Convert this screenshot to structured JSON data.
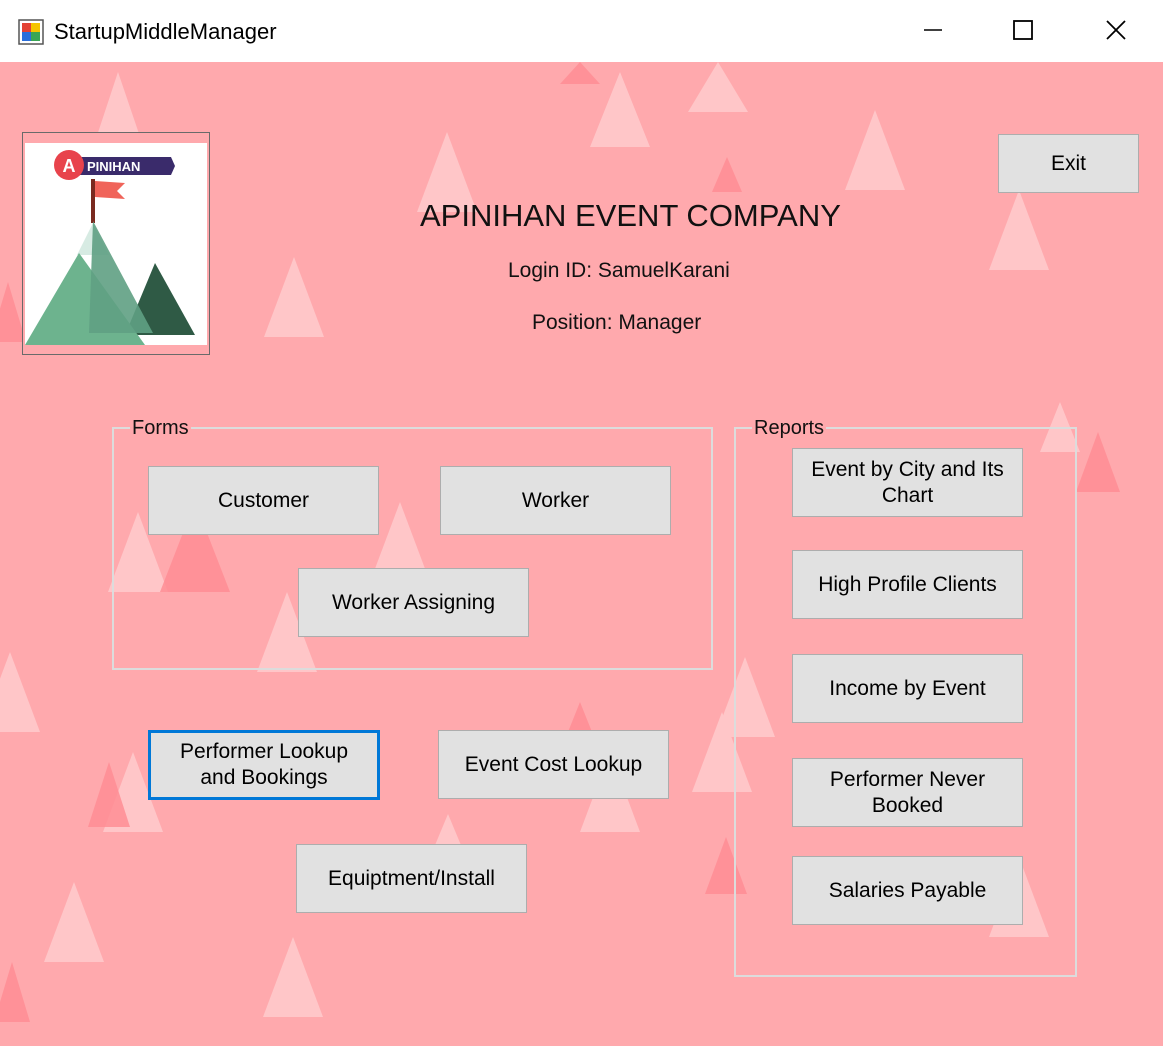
{
  "window": {
    "title": "StartupMiddleManager",
    "controls": [
      "minimize-icon",
      "maximize-icon",
      "close-icon"
    ]
  },
  "header": {
    "logo_text": "PINIHAN",
    "logo_letter": "A",
    "company_name": "APINIHAN EVENT COMPANY",
    "login_id": "Login ID: SamuelKarani",
    "position": "Position: Manager"
  },
  "exit_label": "Exit",
  "forms": {
    "label": "Forms",
    "customer": "Customer",
    "worker": "Worker",
    "worker_assigning": "Worker Assigning"
  },
  "standalone": {
    "performer_lookup": "Performer Lookup\nand Bookings",
    "event_cost_lookup": "Event Cost Lookup",
    "equipment_install": "Equiptment/Install"
  },
  "reports": {
    "label": "Reports",
    "event_by_city": "Event by City and Its\nChart",
    "high_profile": "High Profile Clients",
    "income_by_event": "Income by Event",
    "performer_never": "Performer Never\nBooked",
    "salaries_payable": "Salaries Payable"
  },
  "colors": {
    "background": "#ffa9ad",
    "button": "#e1e1e1",
    "focus": "#0078d7",
    "logo_banner": "#3a2b6b",
    "logo_badge": "#e8434c"
  }
}
